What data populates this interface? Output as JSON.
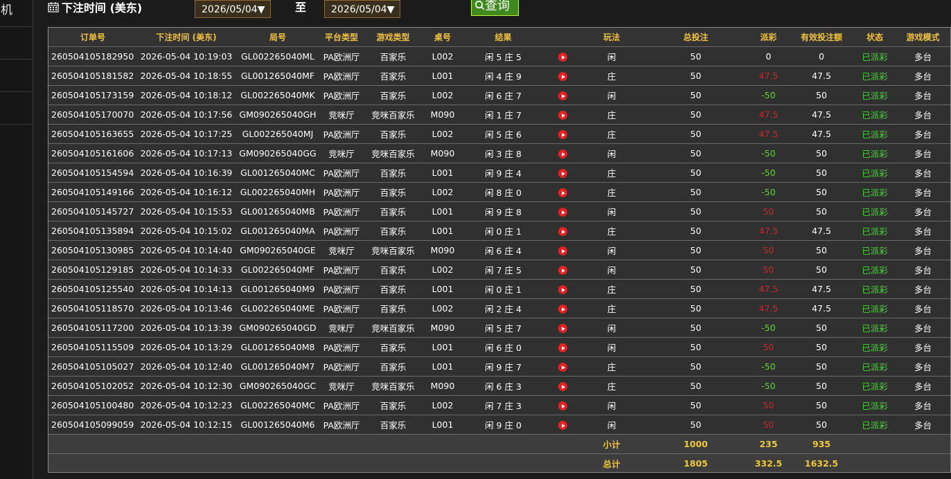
{
  "sidebar": {
    "items": [
      "机",
      "",
      "",
      ""
    ]
  },
  "filter": {
    "title": "下注时间 (美东)",
    "date_from": "2026/05/04▼",
    "to_label": "至",
    "date_to": "2026/05/04▼",
    "query_label": "查询"
  },
  "columns": [
    "订单号",
    "下注时间 (美东)",
    "局号",
    "平台类型",
    "游戏类型",
    "桌号",
    "结果",
    "",
    "玩法",
    "总投注",
    "派彩",
    "有效投注额",
    "状态",
    "游戏模式"
  ],
  "rows": [
    [
      "260504105182950",
      "2026-05-04 10:19:03",
      "GL002265040ML",
      "PA欧洲厅",
      "百家乐",
      "L002",
      "闲 5 庄 5",
      "闲",
      "50",
      "0",
      "0",
      "已派彩",
      "多台"
    ],
    [
      "260504105181582",
      "2026-05-04 10:18:55",
      "GL001265040MF",
      "PA欧洲厅",
      "百家乐",
      "L001",
      "闲 4 庄 9",
      "庄",
      "50",
      "47.5",
      "47.5",
      "已派彩",
      "多台"
    ],
    [
      "260504105173159",
      "2026-05-04 10:18:12",
      "GL002265040MK",
      "PA欧洲厅",
      "百家乐",
      "L002",
      "闲 6 庄 7",
      "闲",
      "50",
      "-50",
      "50",
      "已派彩",
      "多台"
    ],
    [
      "260504105170070",
      "2026-05-04 10:17:56",
      "GM090265040GH",
      "竞咪厅",
      "竞咪百家乐",
      "M090",
      "闲 1 庄 7",
      "庄",
      "50",
      "47.5",
      "47.5",
      "已派彩",
      "多台"
    ],
    [
      "260504105163655",
      "2026-05-04 10:17:25",
      "GL002265040MJ",
      "PA欧洲厅",
      "百家乐",
      "L002",
      "闲 5 庄 6",
      "庄",
      "50",
      "47.5",
      "47.5",
      "已派彩",
      "多台"
    ],
    [
      "260504105161606",
      "2026-05-04 10:17:13",
      "GM090265040GG",
      "竞咪厅",
      "竞咪百家乐",
      "M090",
      "闲 3 庄 8",
      "闲",
      "50",
      "-50",
      "50",
      "已派彩",
      "多台"
    ],
    [
      "260504105154594",
      "2026-05-04 10:16:39",
      "GL001265040MC",
      "PA欧洲厅",
      "百家乐",
      "L001",
      "闲 9 庄 4",
      "庄",
      "50",
      "-50",
      "50",
      "已派彩",
      "多台"
    ],
    [
      "260504105149166",
      "2026-05-04 10:16:12",
      "GL002265040MH",
      "PA欧洲厅",
      "百家乐",
      "L002",
      "闲 8 庄 0",
      "庄",
      "50",
      "-50",
      "50",
      "已派彩",
      "多台"
    ],
    [
      "260504105145727",
      "2026-05-04 10:15:53",
      "GL001265040MB",
      "PA欧洲厅",
      "百家乐",
      "L001",
      "闲 9 庄 8",
      "闲",
      "50",
      "50",
      "50",
      "已派彩",
      "多台"
    ],
    [
      "260504105135894",
      "2026-05-04 10:15:02",
      "GL001265040MA",
      "PA欧洲厅",
      "百家乐",
      "L001",
      "闲 0 庄 1",
      "庄",
      "50",
      "47.5",
      "47.5",
      "已派彩",
      "多台"
    ],
    [
      "260504105130985",
      "2026-05-04 10:14:40",
      "GM090265040GE",
      "竞咪厅",
      "竞咪百家乐",
      "M090",
      "闲 6 庄 4",
      "闲",
      "50",
      "50",
      "50",
      "已派彩",
      "多台"
    ],
    [
      "260504105129185",
      "2026-05-04 10:14:33",
      "GL002265040MF",
      "PA欧洲厅",
      "百家乐",
      "L002",
      "闲 7 庄 5",
      "闲",
      "50",
      "50",
      "50",
      "已派彩",
      "多台"
    ],
    [
      "260504105125540",
      "2026-05-04 10:14:13",
      "GL001265040M9",
      "PA欧洲厅",
      "百家乐",
      "L001",
      "闲 0 庄 1",
      "庄",
      "50",
      "47.5",
      "47.5",
      "已派彩",
      "多台"
    ],
    [
      "260504105118570",
      "2026-05-04 10:13:46",
      "GL002265040ME",
      "PA欧洲厅",
      "百家乐",
      "L002",
      "闲 2 庄 4",
      "庄",
      "50",
      "47.5",
      "47.5",
      "已派彩",
      "多台"
    ],
    [
      "260504105117200",
      "2026-05-04 10:13:39",
      "GM090265040GD",
      "竞咪厅",
      "竞咪百家乐",
      "M090",
      "闲 5 庄 7",
      "闲",
      "50",
      "-50",
      "50",
      "已派彩",
      "多台"
    ],
    [
      "260504105115509",
      "2026-05-04 10:13:29",
      "GL001265040M8",
      "PA欧洲厅",
      "百家乐",
      "L001",
      "闲 6 庄 0",
      "闲",
      "50",
      "50",
      "50",
      "已派彩",
      "多台"
    ],
    [
      "260504105105027",
      "2026-05-04 10:12:40",
      "GL001265040M7",
      "PA欧洲厅",
      "百家乐",
      "L001",
      "闲 9 庄 7",
      "庄",
      "50",
      "-50",
      "50",
      "已派彩",
      "多台"
    ],
    [
      "260504105102052",
      "2026-05-04 10:12:30",
      "GM090265040GC",
      "竞咪厅",
      "竞咪百家乐",
      "M090",
      "闲 6 庄 3",
      "庄",
      "50",
      "-50",
      "50",
      "已派彩",
      "多台"
    ],
    [
      "260504105100480",
      "2026-05-04 10:12:23",
      "GL002265040MC",
      "PA欧洲厅",
      "百家乐",
      "L002",
      "闲 7 庄 3",
      "闲",
      "50",
      "50",
      "50",
      "已派彩",
      "多台"
    ],
    [
      "260504105099059",
      "2026-05-04 10:12:15",
      "GL001265040M6",
      "PA欧洲厅",
      "百家乐",
      "L001",
      "闲 9 庄 0",
      "闲",
      "50",
      "50",
      "50",
      "已派彩",
      "多台"
    ]
  ],
  "subtotal": {
    "label": "小计",
    "bet": "1000",
    "payout": "235",
    "valid": "935"
  },
  "total": {
    "label": "总计",
    "bet": "1805",
    "payout": "332.5",
    "valid": "1632.5"
  },
  "colors": {
    "header_text": "#f0c240",
    "payout_negative": "#5fd82a",
    "payout_positive": "#d4232b",
    "status": "#3fdc2a",
    "query_button": "#3e8a1e"
  },
  "icons": {
    "calendar": "calendar-icon",
    "play": "play-video-icon",
    "search": "search-icon"
  }
}
